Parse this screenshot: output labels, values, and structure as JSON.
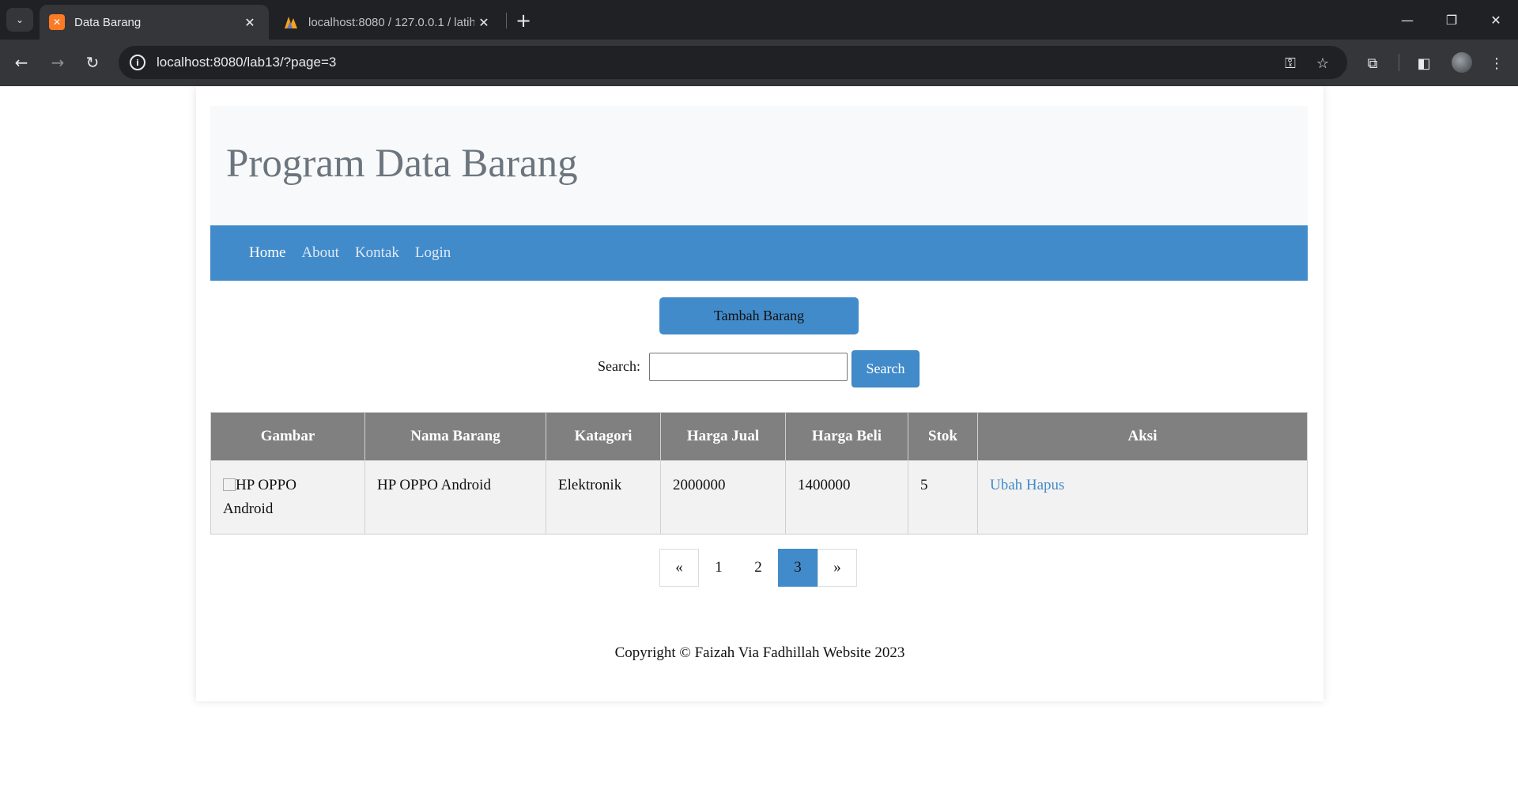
{
  "browser": {
    "tabs": [
      {
        "title": "Data Barang",
        "active": true,
        "icon": "xampp-icon"
      },
      {
        "title": "localhost:8080 / 127.0.0.1 / latih",
        "active": false,
        "icon": "phpmyadmin-icon"
      }
    ],
    "url": "localhost:8080/lab13/?page=3"
  },
  "header": {
    "title": "Program Data Barang"
  },
  "nav": {
    "items": [
      "Home",
      "About",
      "Kontak",
      "Login"
    ]
  },
  "actions": {
    "add_label": "Tambah Barang"
  },
  "search": {
    "label": "Search:",
    "value": "",
    "button": "Search"
  },
  "table": {
    "headers": [
      "Gambar",
      "Nama Barang",
      "Katagori",
      "Harga Jual",
      "Harga Beli",
      "Stok",
      "Aksi"
    ],
    "rows": [
      {
        "gambar_alt": "HP OPPO Android",
        "nama": "HP OPPO Android",
        "kategori": "Elektronik",
        "harga_jual": "2000000",
        "harga_beli": "1400000",
        "stok": "5",
        "aksi_ubah": "Ubah",
        "aksi_hapus": "Hapus"
      }
    ]
  },
  "pagination": {
    "prev": "«",
    "pages": [
      "1",
      "2",
      "3"
    ],
    "current": "3",
    "next": "»"
  },
  "footer": {
    "text": "Copyright © Faizah Via Fadhillah Website 2023"
  },
  "colors": {
    "accent": "#428bca",
    "table_header": "#808080",
    "header_bg": "#f8f9fa"
  }
}
